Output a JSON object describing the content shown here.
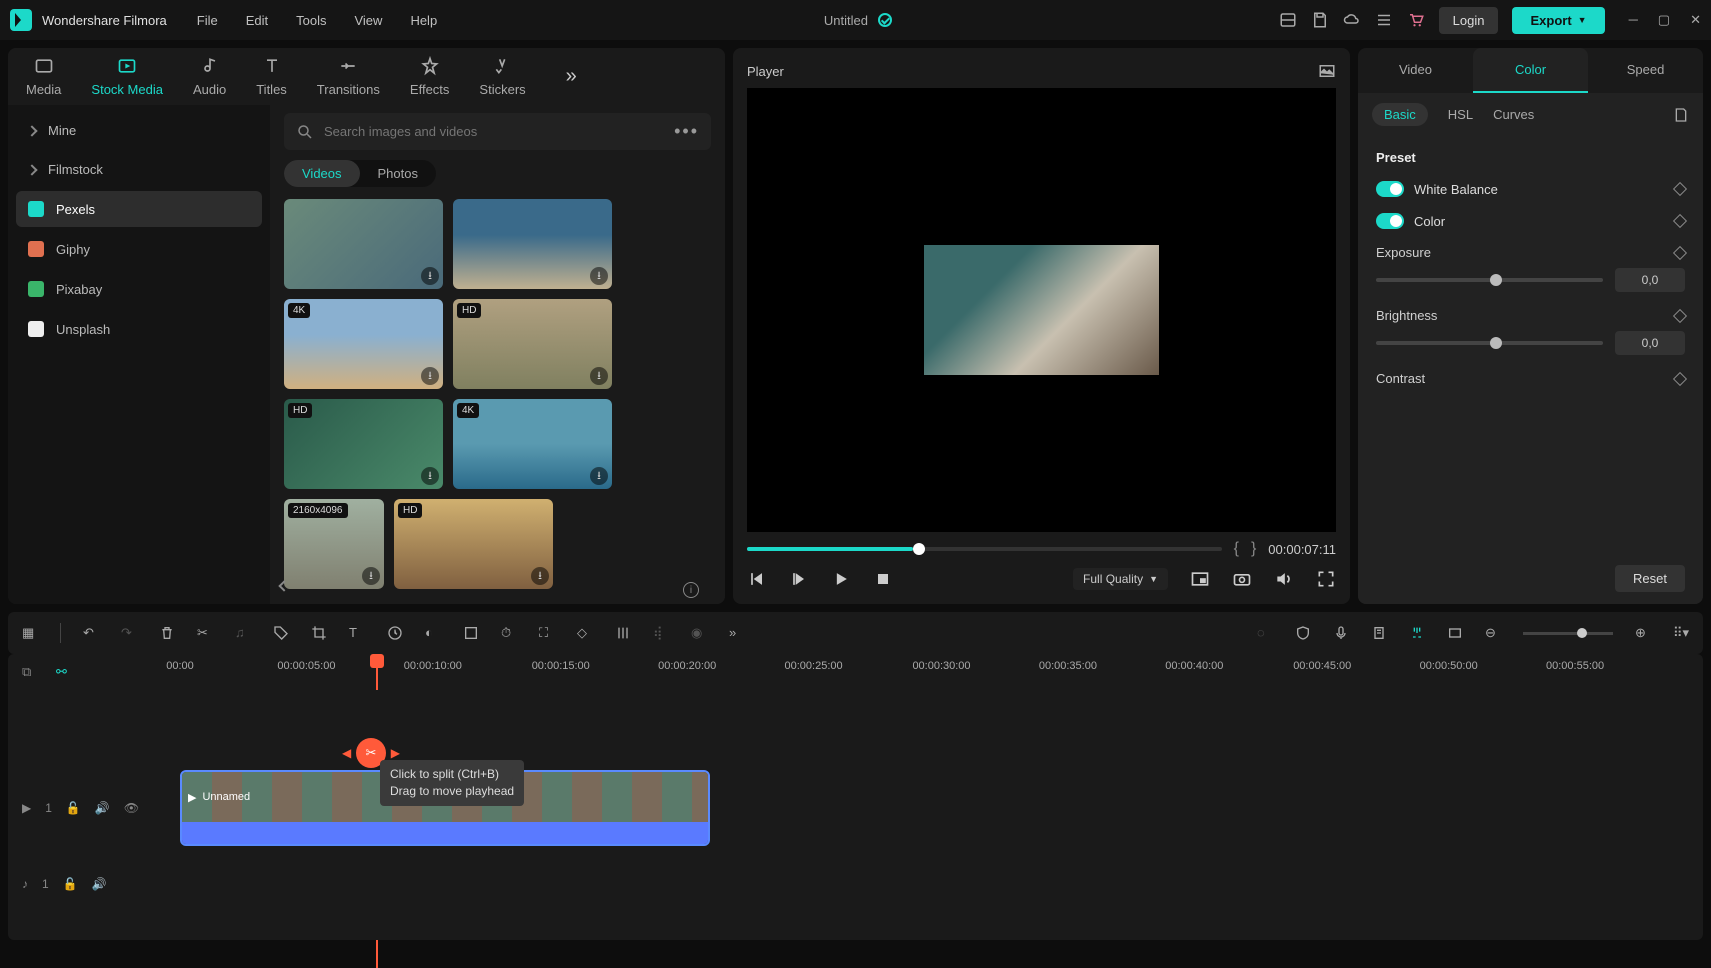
{
  "app_name": "Wondershare Filmora",
  "menu": [
    "File",
    "Edit",
    "Tools",
    "View",
    "Help"
  ],
  "doc_title": "Untitled",
  "login": "Login",
  "export": "Export",
  "top_tabs": [
    {
      "label": "Media"
    },
    {
      "label": "Stock Media"
    },
    {
      "label": "Audio"
    },
    {
      "label": "Titles"
    },
    {
      "label": "Transitions"
    },
    {
      "label": "Effects"
    },
    {
      "label": "Stickers"
    }
  ],
  "sidebar": {
    "items": [
      {
        "label": "Mine",
        "color": "#888",
        "expandable": true
      },
      {
        "label": "Filmstock",
        "color": "#888",
        "expandable": true
      },
      {
        "label": "Pexels",
        "color": "#1cd9c9",
        "active": true
      },
      {
        "label": "Giphy",
        "color": "#e07050"
      },
      {
        "label": "Pixabay",
        "color": "#3ab56a"
      },
      {
        "label": "Unsplash",
        "color": "#eee"
      }
    ]
  },
  "search_placeholder": "Search images and videos",
  "seg": {
    "videos": "Videos",
    "photos": "Photos"
  },
  "thumbs": [
    {
      "badge": "",
      "cls": "water"
    },
    {
      "badge": "",
      "cls": "ocean"
    },
    {
      "badge": "4K",
      "cls": "beach"
    },
    {
      "badge": "HD",
      "cls": "van"
    },
    {
      "badge": "HD",
      "cls": "tropical"
    },
    {
      "badge": "4K",
      "cls": "coast"
    },
    {
      "badge": "2160x4096",
      "cls": "people",
      "small": true
    },
    {
      "badge": "HD",
      "cls": "sunset"
    }
  ],
  "player": {
    "title": "Player",
    "timecode": "00:00:07:11",
    "quality": "Full Quality"
  },
  "right": {
    "tabs": [
      "Video",
      "Color",
      "Speed"
    ],
    "sub": [
      "Basic",
      "HSL",
      "Curves"
    ],
    "preset": "Preset",
    "wb": "White Balance",
    "color": "Color",
    "exposure": "Exposure",
    "brightness": "Brightness",
    "contrast": "Contrast",
    "val_zero": "0,0",
    "reset": "Reset"
  },
  "ruler": [
    "00:00",
    "00:00:05:00",
    "00:00:10:00",
    "00:00:15:00",
    "00:00:20:00",
    "00:00:25:00",
    "00:00:30:00",
    "00:00:35:00",
    "00:00:40:00",
    "00:00:45:00",
    "00:00:50:00",
    "00:00:55:00"
  ],
  "clip_name": "Unnamed",
  "tooltip_line1": "Click to split (Ctrl+B)",
  "tooltip_line2": "Drag to move playhead",
  "track_v": "1",
  "track_a": "1"
}
